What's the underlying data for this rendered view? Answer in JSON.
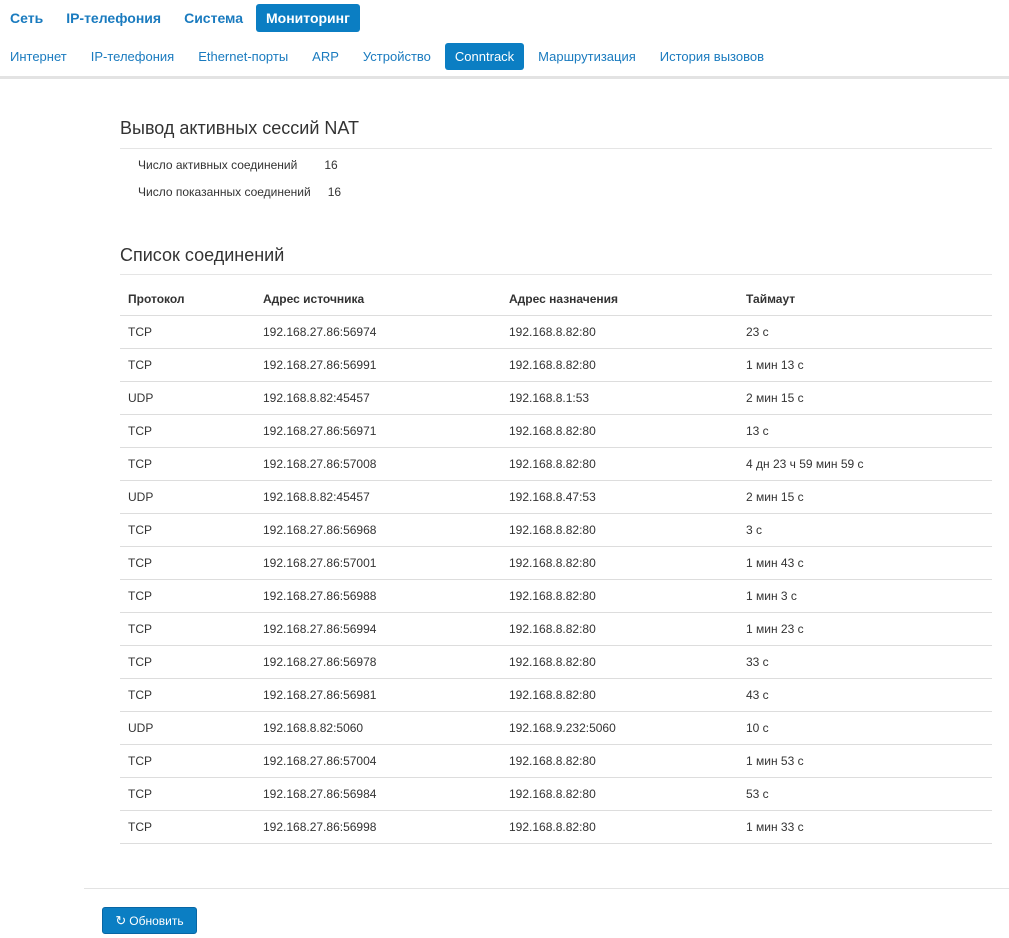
{
  "topnav": {
    "items": [
      {
        "label": "Сеть"
      },
      {
        "label": "IP-телефония"
      },
      {
        "label": "Система"
      },
      {
        "label": "Мониторинг",
        "active": true
      }
    ]
  },
  "subnav": {
    "items": [
      {
        "label": "Интернет"
      },
      {
        "label": "IP-телефония"
      },
      {
        "label": "Ethernet-порты"
      },
      {
        "label": "ARP"
      },
      {
        "label": "Устройство"
      },
      {
        "label": "Conntrack",
        "active": true
      },
      {
        "label": "Маршрутизация"
      },
      {
        "label": "История вызовов"
      }
    ]
  },
  "nat": {
    "title": "Вывод активных сессий NAT",
    "active_label": "Число активных соединений",
    "active_value": "16",
    "shown_label": "Число показанных соединений",
    "shown_value": "16"
  },
  "connections": {
    "title": "Список соединений",
    "headers": [
      "Протокол",
      "Адрес источника",
      "Адрес назначения",
      "Таймаут"
    ],
    "rows": [
      [
        "TCP",
        "192.168.27.86:56974",
        "192.168.8.82:80",
        "23 с"
      ],
      [
        "TCP",
        "192.168.27.86:56991",
        "192.168.8.82:80",
        "1 мин 13 с"
      ],
      [
        "UDP",
        "192.168.8.82:45457",
        "192.168.8.1:53",
        "2 мин 15 с"
      ],
      [
        "TCP",
        "192.168.27.86:56971",
        "192.168.8.82:80",
        "13 с"
      ],
      [
        "TCP",
        "192.168.27.86:57008",
        "192.168.8.82:80",
        "4 дн 23 ч 59 мин 59 с"
      ],
      [
        "UDP",
        "192.168.8.82:45457",
        "192.168.8.47:53",
        "2 мин 15 с"
      ],
      [
        "TCP",
        "192.168.27.86:56968",
        "192.168.8.82:80",
        "3 с"
      ],
      [
        "TCP",
        "192.168.27.86:57001",
        "192.168.8.82:80",
        "1 мин 43 с"
      ],
      [
        "TCP",
        "192.168.27.86:56988",
        "192.168.8.82:80",
        "1 мин 3 с"
      ],
      [
        "TCP",
        "192.168.27.86:56994",
        "192.168.8.82:80",
        "1 мин 23 с"
      ],
      [
        "TCP",
        "192.168.27.86:56978",
        "192.168.8.82:80",
        "33 с"
      ],
      [
        "TCP",
        "192.168.27.86:56981",
        "192.168.8.82:80",
        "43 с"
      ],
      [
        "UDP",
        "192.168.8.82:5060",
        "192.168.9.232:5060",
        "10 с"
      ],
      [
        "TCP",
        "192.168.27.86:57004",
        "192.168.8.82:80",
        "1 мин 53 с"
      ],
      [
        "TCP",
        "192.168.27.86:56984",
        "192.168.8.82:80",
        "53 с"
      ],
      [
        "TCP",
        "192.168.27.86:56998",
        "192.168.8.82:80",
        "1 мин 33 с"
      ]
    ]
  },
  "refresh": {
    "label": "Обновить",
    "icon": "refresh-icon"
  },
  "colors": {
    "accent": "#0b7ec3",
    "link": "#1a7bbf"
  }
}
